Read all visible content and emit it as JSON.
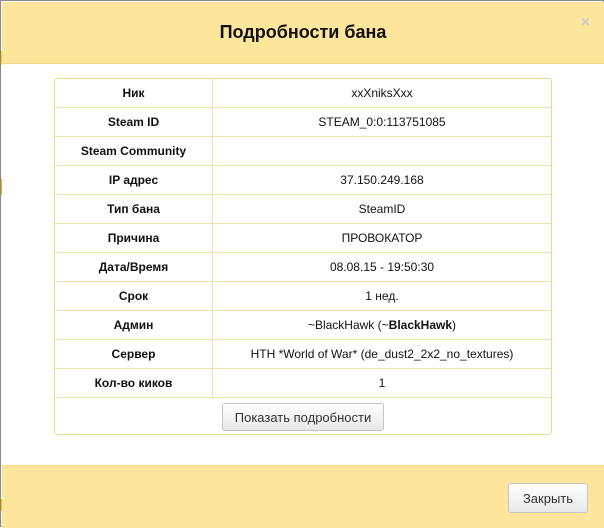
{
  "dialog": {
    "title": "Подробности бана",
    "close_symbol": "×"
  },
  "details": {
    "rows": [
      {
        "label": "Ник",
        "value": "xxXniksXxx"
      },
      {
        "label": "Steam ID",
        "value": "STEAM_0:0:113751085"
      },
      {
        "label": "Steam Community",
        "value": ""
      },
      {
        "label": "IP адрес",
        "value": "37.150.249.168"
      },
      {
        "label": "Тип бана",
        "value": "SteamID"
      },
      {
        "label": "Причина",
        "value": "ПРОВОКАТОР"
      },
      {
        "label": "Дата/Время",
        "value": "08.08.15 - 19:50:30"
      },
      {
        "label": "Срок",
        "value": "1 нед."
      },
      {
        "label": "Админ",
        "value_prefix": "~BlackHawk (~",
        "value_bold": "BlackHawk",
        "value_suffix": ")"
      },
      {
        "label": "Сервер",
        "value": "HTH *World of War* (de_dust2_2x2_no_textures)"
      },
      {
        "label": "Кол-во киков",
        "value": "1"
      }
    ],
    "show_more_label": "Показать подробности"
  },
  "footer": {
    "close_label": "Закрыть"
  }
}
